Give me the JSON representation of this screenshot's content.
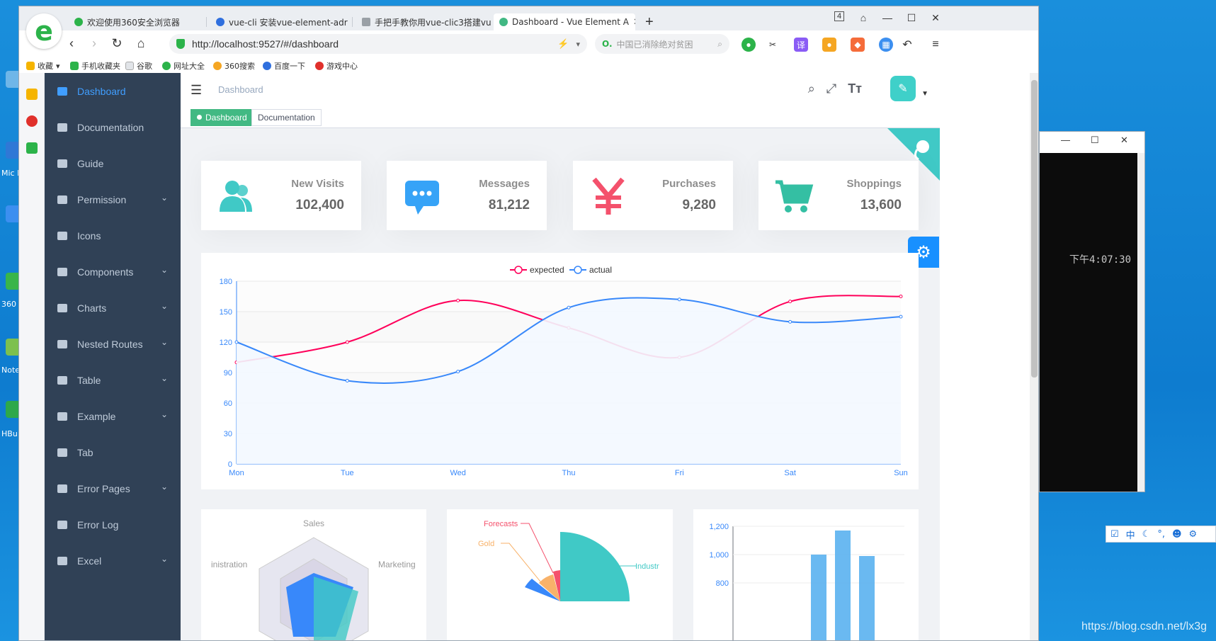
{
  "desktop": {
    "labels": [
      "Mic E",
      "360",
      "Note",
      "HBu"
    ],
    "watermark": "https://blog.csdn.net/lx3g"
  },
  "browser": {
    "tabs": [
      {
        "label": "欢迎使用360安全浏览器",
        "color": "#2cb34a"
      },
      {
        "label": "vue-cli 安装vue-element-adr",
        "color": "#2f6fde"
      },
      {
        "label": "手把手教你用vue-clic3搭建vu",
        "color": "#9aa0a6"
      },
      {
        "label": "Dashboard - Vue Element A",
        "color": "#41b883"
      }
    ],
    "tab_count_badge": "4",
    "url": "http://localhost:9527/#/dashboard",
    "search_placeholder": "中国已消除绝对贫困",
    "bookmarks": [
      "收藏",
      "手机收藏夹",
      "谷歌",
      "网址大全",
      "360搜索",
      "百度一下",
      "游戏中心"
    ]
  },
  "sidebar": {
    "items": [
      {
        "label": "Dashboard",
        "active": true,
        "chevron": false
      },
      {
        "label": "Documentation",
        "active": false,
        "chevron": false
      },
      {
        "label": "Guide",
        "active": false,
        "chevron": false
      },
      {
        "label": "Permission",
        "active": false,
        "chevron": true
      },
      {
        "label": "Icons",
        "active": false,
        "chevron": false
      },
      {
        "label": "Components",
        "active": false,
        "chevron": true
      },
      {
        "label": "Charts",
        "active": false,
        "chevron": true
      },
      {
        "label": "Nested Routes",
        "active": false,
        "chevron": true
      },
      {
        "label": "Table",
        "active": false,
        "chevron": true
      },
      {
        "label": "Example",
        "active": false,
        "chevron": true
      },
      {
        "label": "Tab",
        "active": false,
        "chevron": false
      },
      {
        "label": "Error Pages",
        "active": false,
        "chevron": true
      },
      {
        "label": "Error Log",
        "active": false,
        "chevron": false
      },
      {
        "label": "Excel",
        "active": false,
        "chevron": true
      }
    ]
  },
  "navbar": {
    "breadcrumb": "Dashboard",
    "icons": [
      "search-icon",
      "fullscreen-icon",
      "font-size-icon"
    ]
  },
  "tags": [
    {
      "label": "Dashboard",
      "active": true
    },
    {
      "label": "Documentation",
      "active": false
    }
  ],
  "cards": [
    {
      "label": "New Visits",
      "value": "102,400",
      "color": "#40c9c6",
      "icon": "people-icon"
    },
    {
      "label": "Messages",
      "value": "81,212",
      "color": "#36a3f7",
      "icon": "message-icon"
    },
    {
      "label": "Purchases",
      "value": "9,280",
      "color": "#f4516c",
      "icon": "money-icon"
    },
    {
      "label": "Shoppings",
      "value": "13,600",
      "color": "#34bfa3",
      "icon": "shopping-icon"
    }
  ],
  "chart_data": [
    {
      "type": "line",
      "categories": [
        "Mon",
        "Tue",
        "Wed",
        "Thu",
        "Fri",
        "Sat",
        "Sun"
      ],
      "series": [
        {
          "name": "expected",
          "values": [
            100,
            120,
            161,
            134,
            105,
            160,
            165
          ],
          "color": "#ff005a"
        },
        {
          "name": "actual",
          "values": [
            120,
            82,
            91,
            154,
            162,
            140,
            145
          ],
          "color": "#3888fa"
        }
      ],
      "ylim": [
        0,
        180
      ],
      "yticks": [
        0,
        30,
        60,
        90,
        120,
        150,
        180
      ],
      "legend": "top-center"
    },
    {
      "type": "radar",
      "indicators": [
        "Sales",
        "Marketing",
        "inistration"
      ]
    },
    {
      "type": "pie",
      "labels": [
        "Forecasts",
        "Gold",
        "Industr"
      ]
    },
    {
      "type": "bar",
      "yticks": [
        "1,200",
        "1,000",
        "800"
      ],
      "values": [
        1000,
        1180,
        990
      ]
    }
  ],
  "console": {
    "time": "下午4:07:30"
  },
  "ime": {
    "label": "中"
  }
}
